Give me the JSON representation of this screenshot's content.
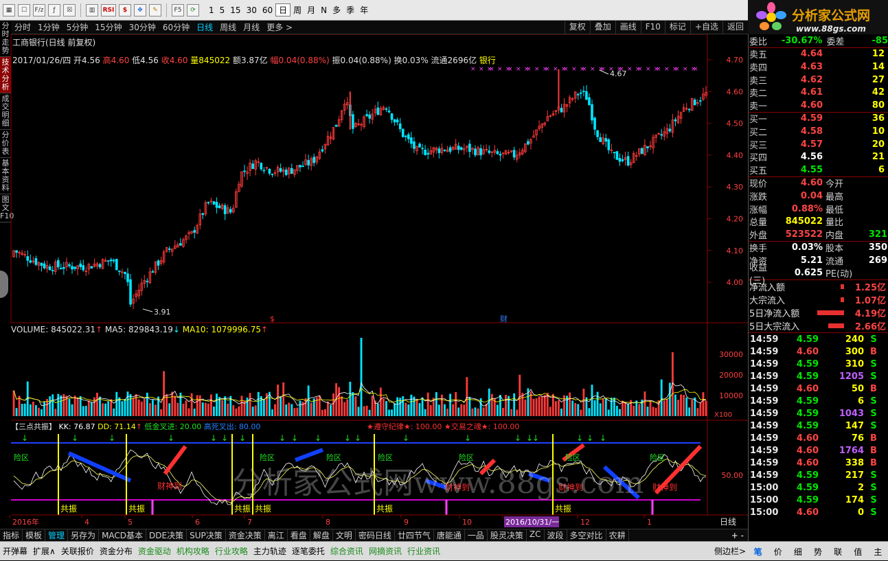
{
  "toolbar": {
    "icons": [
      "grid-icon",
      "table-icon",
      "fiz-icon",
      "function-icon",
      "close-box-icon",
      "chart-icon",
      "rsi-icon",
      "dollar-icon",
      "move-icon",
      "pen-icon",
      "f5-icon",
      "refresh-icon"
    ],
    "rsi_label": "RSI",
    "fiz_label": "F/z",
    "f5_label": "F5",
    "periods": [
      "1",
      "5",
      "15",
      "30",
      "60",
      "日",
      "周",
      "月",
      "N",
      "多",
      "季",
      "年"
    ],
    "selected_period": "日"
  },
  "logo": {
    "title": "分析家公式网",
    "url_text": "www.88gs.com"
  },
  "periodbar": {
    "items": [
      "分时",
      "1分钟",
      "5分钟",
      "15分钟",
      "30分钟",
      "60分钟",
      "日线",
      "周线",
      "月线",
      "更多 >"
    ],
    "selected": "日线",
    "right_buttons": [
      "复权",
      "叠加",
      "画线",
      "F10",
      "标记",
      "+自选",
      "返回"
    ]
  },
  "sidetabs": [
    "分时走势",
    "技术分析",
    "成交明细",
    "分价表",
    "基本资料",
    "图文F10"
  ],
  "selected_sidetab": "技术分析",
  "main_chart": {
    "title": "工商银行(日线 前复权)",
    "info": {
      "date": "2017/01/26/四",
      "open_label": "开",
      "open": "4.56",
      "high_label": "高",
      "high": "4.60",
      "low_label": "低",
      "low": "4.56",
      "close_label": "收",
      "close": "4.60",
      "vol_label": "量",
      "vol": "845022",
      "amount_label": "额",
      "amount": "3.87亿",
      "change_label": "幅",
      "change": "0.04(0.88%)",
      "amplitude_label": "振",
      "amplitude": "0.04(0.88%)",
      "turnover_label": "换",
      "turnover": "0.03%",
      "float_label": "流通",
      "float": "2696亿",
      "sector": "银行"
    },
    "price_axis": [
      "4.70",
      "4.60",
      "4.50",
      "4.40",
      "4.30",
      "4.20",
      "4.10",
      "4.00"
    ],
    "max_label": "4.67",
    "min_label": "3.91",
    "cai_label": "财",
    "dollar_label": "$"
  },
  "volume_chart": {
    "vol_label": "VOLUME:",
    "vol": "845022.31",
    "ma5_label": "MA5:",
    "ma5": "829843.19",
    "ma10_label": "MA10:",
    "ma10": "1079996.75",
    "axis": [
      "30000",
      "20000",
      "10000"
    ],
    "unit": "X100"
  },
  "indicator": {
    "name": "【三点共振】",
    "kk_label": "KK:",
    "kk": "76.87",
    "dd_label": "DD:",
    "dd": "71.14",
    "low_gold": "低金叉进: 20.00",
    "high_dead": "高死叉出: 80.00",
    "rule1": "★遵守纪律★: 100.00",
    "rule2": "★交易之魂★: 100.00",
    "axis_50": "50.00",
    "gongzhen": "共振",
    "xianqu": "险区",
    "caishen": "财神到"
  },
  "date_axis": [
    "2016年",
    "4",
    "5",
    "6",
    "7",
    "8",
    "9",
    "10",
    "2016/10/31/一",
    "12",
    "1"
  ],
  "date_period_label": "日线",
  "watermark": "分析家公式网www.88gs.com",
  "quote": {
    "weibi_label": "委比",
    "weibi": "-30.67%",
    "weicha_label": "委差",
    "weicha": "-85",
    "sell": [
      {
        "label": "卖五",
        "price": "4.64",
        "vol": "12"
      },
      {
        "label": "卖四",
        "price": "4.63",
        "vol": "14"
      },
      {
        "label": "卖三",
        "price": "4.62",
        "vol": "27"
      },
      {
        "label": "卖二",
        "price": "4.61",
        "vol": "42"
      },
      {
        "label": "卖一",
        "price": "4.60",
        "vol": "80"
      }
    ],
    "buy": [
      {
        "label": "买一",
        "price": "4.59",
        "vol": "36"
      },
      {
        "label": "买二",
        "price": "4.58",
        "vol": "10"
      },
      {
        "label": "买三",
        "price": "4.57",
        "vol": "20"
      },
      {
        "label": "买四",
        "price": "4.56",
        "vol": "21"
      },
      {
        "label": "买五",
        "price": "4.55",
        "vol": "6"
      }
    ],
    "stats": [
      {
        "l1": "现价",
        "v1": "4.60",
        "c1": "red",
        "l2": "今开",
        "v2": ""
      },
      {
        "l1": "涨跌",
        "v1": "0.04",
        "c1": "red",
        "l2": "最高",
        "v2": ""
      },
      {
        "l1": "涨幅",
        "v1": "0.88%",
        "c1": "red",
        "l2": "最低",
        "v2": ""
      },
      {
        "l1": "总量",
        "v1": "845022",
        "c1": "yellow",
        "l2": "量比",
        "v2": ""
      },
      {
        "l1": "外盘",
        "v1": "523522",
        "c1": "red",
        "l2": "内盘",
        "v2": "321"
      }
    ],
    "stats2": [
      {
        "l1": "换手",
        "v1": "0.03%",
        "l2": "股本",
        "v2": "350"
      },
      {
        "l1": "净资",
        "v1": "5.21",
        "l2": "流通",
        "v2": "269"
      },
      {
        "l1": "收益(三)",
        "v1": "0.625",
        "l2": "PE(动)",
        "v2": ""
      }
    ],
    "flows": [
      {
        "label": "净流入额",
        "bar": 0.1,
        "value": "1.25亿"
      },
      {
        "label": "大宗流入",
        "bar": 0.1,
        "value": "1.07亿"
      },
      {
        "label": "5日净流入额",
        "bar": 0.85,
        "value": "4.19亿"
      },
      {
        "label": "5日大宗流入",
        "bar": 0.5,
        "value": "2.66亿"
      }
    ],
    "ticks": [
      {
        "t": "14:59",
        "p": "4.59",
        "v": "240",
        "d": "S",
        "vc": "yellow"
      },
      {
        "t": "14:59",
        "p": "4.60",
        "v": "300",
        "d": "B",
        "vc": "yellow"
      },
      {
        "t": "14:59",
        "p": "4.59",
        "v": "310",
        "d": "S",
        "vc": "yellow"
      },
      {
        "t": "14:59",
        "p": "4.59",
        "v": "1205",
        "d": "S",
        "vc": "purple"
      },
      {
        "t": "14:59",
        "p": "4.60",
        "v": "50",
        "d": "B",
        "vc": "yellow"
      },
      {
        "t": "14:59",
        "p": "4.59",
        "v": "6",
        "d": "S",
        "vc": "yellow"
      },
      {
        "t": "14:59",
        "p": "4.59",
        "v": "1043",
        "d": "S",
        "vc": "purple"
      },
      {
        "t": "14:59",
        "p": "4.59",
        "v": "147",
        "d": "S",
        "vc": "yellow"
      },
      {
        "t": "14:59",
        "p": "4.60",
        "v": "76",
        "d": "B",
        "vc": "yellow"
      },
      {
        "t": "14:59",
        "p": "4.60",
        "v": "1764",
        "d": "B",
        "vc": "purple"
      },
      {
        "t": "14:59",
        "p": "4.60",
        "v": "338",
        "d": "B",
        "vc": "yellow"
      },
      {
        "t": "14:59",
        "p": "4.59",
        "v": "217",
        "d": "S",
        "vc": "yellow"
      },
      {
        "t": "15:00",
        "p": "4.59",
        "v": "2",
        "d": "S",
        "vc": "yellow"
      },
      {
        "t": "15:00",
        "p": "4.59",
        "v": "174",
        "d": "S",
        "vc": "yellow"
      },
      {
        "t": "15:00",
        "p": "4.60",
        "v": "0",
        "d": "S",
        "vc": "yellow"
      }
    ]
  },
  "bottombar": {
    "items": [
      "指标",
      "模板",
      "管理",
      "另存为",
      "MACD基本",
      "DDE决策",
      "SUP决策",
      "资金决策",
      "离江",
      "看盘",
      "解盘",
      "文明",
      "密码日线",
      "廿四节气",
      "唐能通",
      "一品",
      "股灵决策",
      "ZC",
      "波段",
      "多空对比",
      "农耕"
    ],
    "selected": "管理",
    "right": "+ -"
  },
  "statusbar": {
    "items": [
      "开弹幕",
      "扩展∧",
      "关联报价",
      "资金分布",
      "资金驱动",
      "机构攻略",
      "行业攻略",
      "主力轨迹",
      "逐笔委托",
      "综合资讯",
      "网摘资讯",
      "行业资讯"
    ],
    "right_label": "侧边栏>",
    "tabs": [
      "笔",
      "价",
      "细",
      "势",
      "联",
      "值",
      "主"
    ],
    "selected_tab": "笔"
  },
  "colors": {
    "up": "#ff3b3b",
    "down": "#00e5ff",
    "ma5": "#ffffff",
    "ma10": "#ffff00",
    "accent": "#00d0ff"
  }
}
